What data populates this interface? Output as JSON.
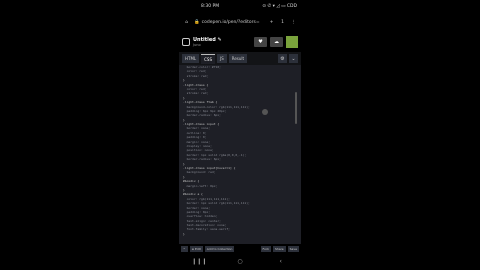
{
  "status": {
    "time": "8:30 PM",
    "icons": "⊙ ✆ ▾ ◿ ▭ CDD"
  },
  "url": {
    "text": "codepen.io/pen/?editors=",
    "tab_count": "1"
  },
  "pen": {
    "title": "Untitled ✎",
    "subtitle": "Juno"
  },
  "header_buttons": [
    "♥",
    "☁"
  ],
  "tabs": [
    "HTML",
    "CSS",
    "JS",
    "Result"
  ],
  "active_tab": "CSS",
  "code": [
    "  border-color: #f10;",
    "  color: red;",
    "  stroke: red;",
    "}",
    ".light-dress {",
    "  color: red;",
    "  stroke: red;",
    "}",
    ".light-dress ftab {",
    "  background-color: rgb(111,111,111);",
    "  padding: 6px 9px 20px;",
    "  border-radius: 6px;",
    "}",
    ".light-dress input {",
    "  border: none;",
    "  outline: 0;",
    "  padding: 0;",
    "  margin: none;",
    "  display: none;",
    "  position: none;",
    "  border: 1px solid rgba(0,0,0,.1);",
    "  border-radius: 6px;",
    "}",
    ".light-dress input[hover=1] {",
    "  background: red;",
    "}",
    "#boxdiv {",
    "  margin-left: 0px;",
    "}",
    "#boxdiv a {",
    "  color: rgb(111,111,111);",
    "  border: 1px solid rgb(111,111,111);",
    "  border: none;",
    "  padding: 0px;",
    "  overflow: hidden;",
    "  text-align: center;",
    "  text-decoration: none;",
    "  font-family: sans-serif;",
    "}"
  ],
  "bottom_bar": {
    "expand": "^",
    "labels": [
      "≡ Edit",
      "Add to Collection"
    ],
    "right": [
      "Fork",
      "Share",
      "Save"
    ]
  },
  "nav": [
    "❙❙❙",
    "○",
    "‹"
  ]
}
